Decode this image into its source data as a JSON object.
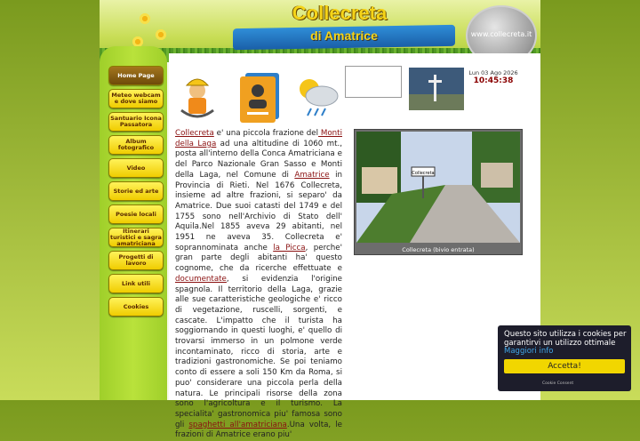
{
  "header": {
    "title": "Collecreta",
    "subtitle": "di Amatrice",
    "badge_text": "www.collecreta.it"
  },
  "nav": [
    {
      "label": "Home Page",
      "active": true
    },
    {
      "label": "Meteo webcam e dove siamo"
    },
    {
      "label": "Santuario Icona Passatora"
    },
    {
      "label": "Album fotografico"
    },
    {
      "label": "Video"
    },
    {
      "label": "Storie ed arte"
    },
    {
      "label": "Poesie  locali"
    },
    {
      "label": "Itinerari turistici e sagra amatriciana"
    },
    {
      "label": "Progetti di lavoro"
    },
    {
      "label": "Link utili"
    },
    {
      "label": "Cookies"
    }
  ],
  "icons": [
    "worker-icon",
    "address-book-icon",
    "weather-icon",
    "webcam-thumbnail",
    "cross-thumbnail"
  ],
  "clock": {
    "date": "Lun 03 Ago 2026",
    "time": "10:45:38"
  },
  "article": {
    "p1": "Collecreta",
    "p2": " e' una piccola frazione del",
    "p3": " Monti della Laga",
    "p4": " ad una altitudine di 1060 mt., posta all'interno della Conca Amatriciana e del Parco Nazionale Gran Sasso e Monti della Laga, nel Comune di ",
    "p5": "Amatrice",
    "p6": " in Provincia di Rieti. Nel 1676 Collecreta, insieme ad altre frazioni, si separo' da Amatrice. Due suoi catasti del 1749 e del 1755 sono nell'Archivio di Stato dell' Aquila.Nel 1855 aveva 29 abitanti, nel 1951 ne aveva   35. Collecreta e' soprannominata anche ",
    "p7": " la  Picca",
    "p8": ", perche' gran parte degli abitanti ha' questo cognome, che da ricerche effettuate    e   ",
    "p9": "documentate",
    "p10": ",   si   evidenzia l'origine spagnola. Il territorio della Laga, grazie alle sue caratteristiche geologiche e' ricco di vegetazione, ruscelli, sorgenti, e cascate.    L'impatto   che   il   turista   ha soggiornando in questi luoghi, e' quello di trovarsi immerso in un polmone verde incontaminato, ricco di storia, arte e tradizioni gastronomiche. Se poi teniamo conto di essere a soli 150 Km da Roma, si puo' considerare una piccola perla della natura. Le principali risorse della zona sono l'agricoltura e il turismo.    La  specialita'  gastronomica  piu' famosa sono gli ",
    "p11": "spaghetti all'amatriciana",
    "p12": ".Una volta, le frazioni di Amatrice erano piu'"
  },
  "photo": {
    "caption": "Collecreta (bivio entrata)",
    "sign": "Collecreta"
  },
  "cookie": {
    "message": "Questo sito utilizza i cookies per garantirvi un utilizzo ottimale ",
    "link": "Maggiori info",
    "button": "Accetta!",
    "footer": "Cookie Consent"
  },
  "colors": {
    "accent": "#f1d600",
    "link": "#8a1010",
    "clock": "#8a0000"
  }
}
